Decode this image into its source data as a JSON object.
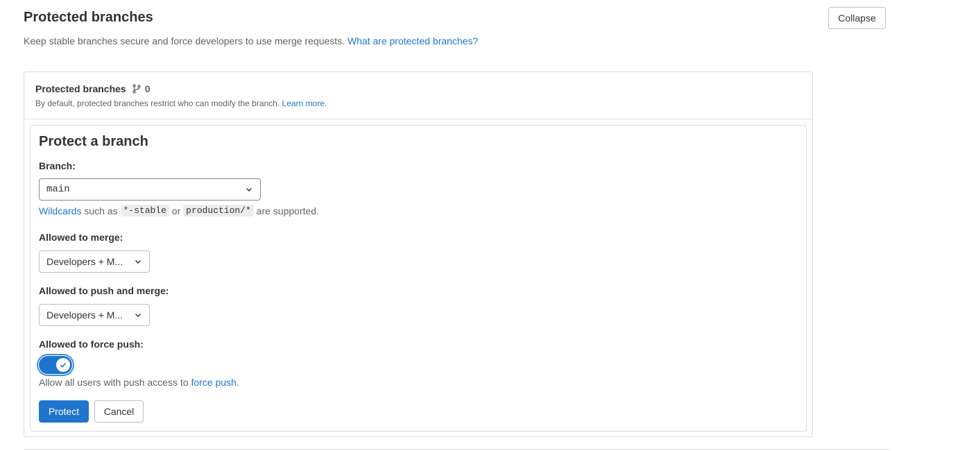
{
  "header": {
    "title": "Protected branches",
    "collapse_label": "Collapse",
    "description": "Keep stable branches secure and force developers to use merge requests.",
    "help_link": "What are protected branches?"
  },
  "card": {
    "title": "Protected branches",
    "count": "0",
    "description": "By default, protected branches restrict who can modify the branch.",
    "learn_more": "Learn more."
  },
  "form": {
    "heading": "Protect a branch",
    "branch_label": "Branch:",
    "branch_value": "main",
    "wildcards": {
      "link": "Wildcards",
      "text1": " such as ",
      "code1": "*-stable",
      "text2": " or ",
      "code2": "production/*",
      "text3": " are supported."
    },
    "merge_label": "Allowed to merge:",
    "merge_value": "Developers + M...",
    "push_label": "Allowed to push and merge:",
    "push_value": "Developers + M...",
    "force_label": "Allowed to force push:",
    "force_enabled": true,
    "force_help_text": "Allow all users with push access to ",
    "force_help_link": "force push",
    "force_help_end": ".",
    "protect_label": "Protect",
    "cancel_label": "Cancel"
  },
  "colors": {
    "accent": "#1f75cb",
    "text": "#333238",
    "muted": "#626168",
    "border": "#dcdcde"
  },
  "icons": {
    "branch": "branch-icon",
    "chevron": "chevron-down-icon",
    "check": "check-icon"
  }
}
